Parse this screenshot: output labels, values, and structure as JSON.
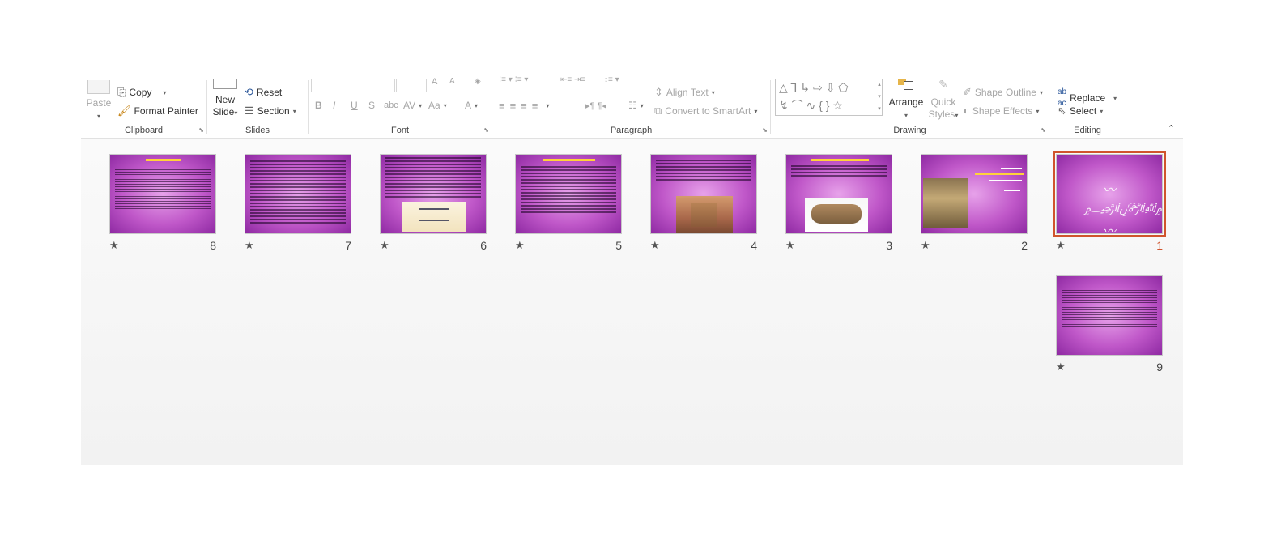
{
  "ribbon": {
    "clipboard": {
      "paste": "Paste",
      "copy": "Copy",
      "format_painter": "Format Painter",
      "label": "Clipboard"
    },
    "slides": {
      "new": "New",
      "slide": "Slide",
      "reset": "Reset",
      "section": "Section",
      "label": "Slides"
    },
    "font": {
      "label": "Font",
      "bold": "B",
      "italic": "I",
      "underline": "U",
      "shadow": "S",
      "strike": "abc",
      "spacing": "AV",
      "case": "Aa",
      "color": "A"
    },
    "paragraph": {
      "label": "Paragraph",
      "align_text": "Align Text",
      "convert": "Convert to SmartArt"
    },
    "drawing": {
      "label": "Drawing",
      "arrange": "Arrange",
      "quick": "Quick",
      "styles": "Styles",
      "outline": "Shape Outline",
      "effects": "Shape Effects"
    },
    "editing": {
      "label": "Editing",
      "replace": "Replace",
      "select": "Select"
    }
  },
  "slides": [
    {
      "number": "1",
      "star": "★",
      "selected": true
    },
    {
      "number": "2",
      "star": "★"
    },
    {
      "number": "3",
      "star": "★"
    },
    {
      "number": "4",
      "star": "★"
    },
    {
      "number": "5",
      "star": "★"
    },
    {
      "number": "6",
      "star": "★"
    },
    {
      "number": "7",
      "star": "★"
    },
    {
      "number": "8",
      "star": "★"
    },
    {
      "number": "9",
      "star": "★"
    }
  ],
  "colors": {
    "accent": "#d0542d",
    "slide_bg": "#c058c9",
    "title": "#ffd23a"
  }
}
